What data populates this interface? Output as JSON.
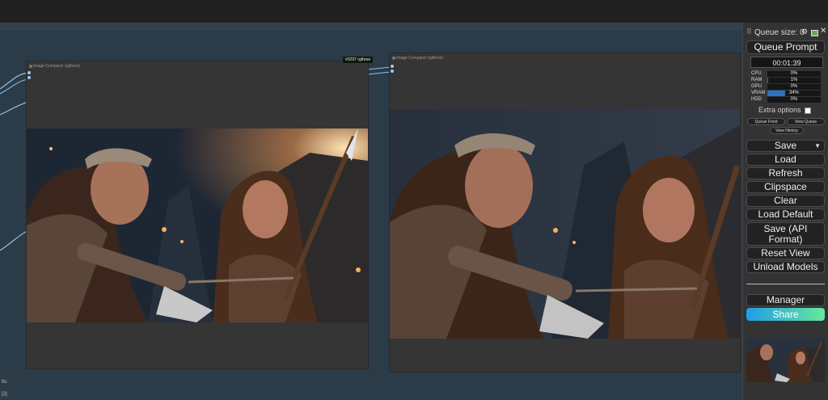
{
  "nodes": {
    "left_title": "Image Comparer (rgthree)",
    "right_title": "Image Comparer (rgthree)",
    "badge": "#3297 rgthree"
  },
  "corner": {
    "line1": "0s",
    "line2": "[2]"
  },
  "panel": {
    "queue_size": "Queue size: 0",
    "queue_prompt": "Queue Prompt",
    "timer": "00:01:39",
    "stats": [
      {
        "label": "CPU",
        "value": "0%",
        "fill": 0
      },
      {
        "label": "RAM",
        "value": "1%",
        "fill": 0.01
      },
      {
        "label": "GPU",
        "value": "0%",
        "fill": 0
      },
      {
        "label": "VRAM",
        "value": "34%",
        "fill": 0.34
      },
      {
        "label": "HDD",
        "value": "0%",
        "fill": 0
      }
    ],
    "extra_options": "Extra options",
    "queue_front": "Queue Front",
    "view_queue": "View Queue",
    "view_history": "View History",
    "save": "Save",
    "load": "Load",
    "refresh": "Refresh",
    "clipspace": "Clipspace",
    "clear": "Clear",
    "load_default": "Load Default",
    "save_api": "Save (API Format)",
    "reset_view": "Reset View",
    "unload_models": "Unload Models",
    "manager": "Manager",
    "share": "Share"
  },
  "colors": {
    "accent": "#2a73c4",
    "share_start": "#1e9de8",
    "share_end": "#68e79c"
  }
}
